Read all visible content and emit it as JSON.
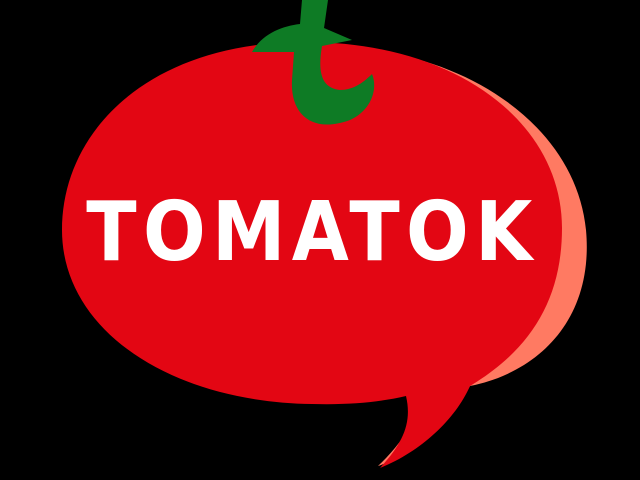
{
  "logo": {
    "brand_name": "TOMATOK",
    "stem_letter": "t",
    "colors": {
      "background": "#000000",
      "tomato_red": "#e30613",
      "tomato_shadow": "#ff7a62",
      "stem_green": "#0e7b25",
      "text": "#ffffff"
    }
  }
}
